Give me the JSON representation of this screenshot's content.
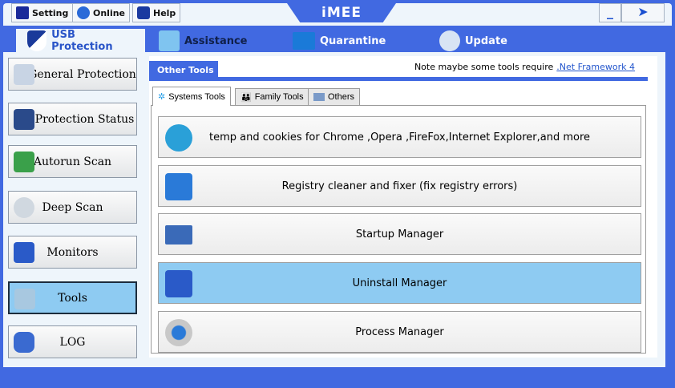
{
  "topbar": {
    "setting": "Setting",
    "online": "Online",
    "help": "Help",
    "logo": "iMEE",
    "minimize": "_"
  },
  "main_tabs": [
    {
      "label": "USB Protection"
    },
    {
      "label": "Assistance"
    },
    {
      "label": "Quarantine"
    },
    {
      "label": "Update"
    }
  ],
  "sidebar": [
    {
      "label": "General Protection"
    },
    {
      "label": "Protection Status"
    },
    {
      "label": "Autorun Scan"
    },
    {
      "label": "Deep Scan"
    },
    {
      "label": "Monitors"
    },
    {
      "label": "Tools"
    },
    {
      "label": "LOG"
    }
  ],
  "panel": {
    "header": "Other Tools",
    "note": "Note maybe some tools require",
    "link": ".Net Framework 4",
    "tabs": [
      {
        "label": "Systems Tools"
      },
      {
        "label": "Family Tools"
      },
      {
        "label": "Others"
      }
    ],
    "tools": [
      {
        "label": "temp and cookies for Chrome ,Opera ,FireFox,Internet Explorer,and more"
      },
      {
        "label": "Registry cleaner and fixer (fix registry errors)"
      },
      {
        "label": "Startup Manager"
      },
      {
        "label": "Uninstall Manager"
      },
      {
        "label": "Process Manager"
      }
    ]
  },
  "colors": {
    "accent": "#4169e1",
    "selected": "#8ecbf2"
  }
}
